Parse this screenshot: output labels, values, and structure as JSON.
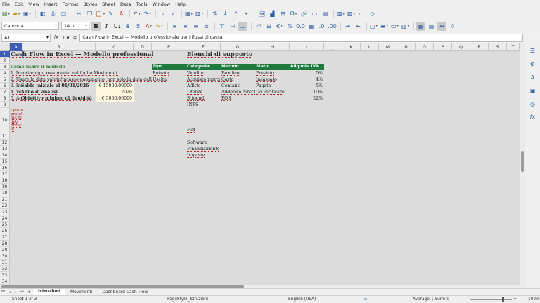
{
  "menu": [
    "File",
    "Edit",
    "View",
    "Insert",
    "Format",
    "Styles",
    "Sheet",
    "Data",
    "Tools",
    "Window",
    "Help"
  ],
  "toolbar2": {
    "font_name": "Cambria",
    "font_size": "14 pt"
  },
  "formula_bar": {
    "cell_ref": "A1",
    "content": "Cash Flow in Excel — Modello professionale per i flussi di cassa"
  },
  "columns": [
    "A",
    "B",
    "C",
    "D",
    "E",
    "F",
    "G",
    "H",
    "I",
    "J",
    "K",
    "L",
    "M",
    "N",
    "O",
    "P",
    "Q",
    "R",
    "S",
    "T"
  ],
  "rows": [
    "1",
    "2",
    "3",
    "4",
    "5",
    "6",
    "7",
    "8",
    "9",
    "10",
    "11",
    "12",
    "13",
    "14",
    "15",
    "16",
    "17",
    "18",
    "19",
    "20",
    "21",
    "22",
    "23",
    "24",
    "25",
    "26",
    "27",
    "28",
    "29",
    "30",
    "31",
    "32",
    "33",
    "34",
    "35"
  ],
  "cells": {
    "title": "Cash Flow in Excel — Modello professionale per i fluss",
    "title_right": "Elenchi di supporto",
    "section_how": "Come usare il modello",
    "steps": [
      "1. Inserire ogni movimento nel foglio Movimenti.",
      "2. Usare la data valuta/incasso-pagamento, non solo la data della fattura.",
      "3. Inse",
      "4. Ver",
      "5. Agg"
    ],
    "labels": {
      "saldo": "Saldo iniziale al 01/01/2026",
      "anno": "Anno di analisi",
      "obiettivo": "Obiettivo minimo di liquidità"
    },
    "values": {
      "saldo": "€ 15000.00000",
      "anno": "2026",
      "obiettivo": "€ 5000.00000"
    },
    "wrapped_a10": [
      "i perio",
      "protot",
      "ate di",
      "deti",
      "prese",
      "al."
    ],
    "lists": {
      "headers": [
        "Tipo",
        "Categoria",
        "Metodo",
        "Stato",
        "Aliquota IVA"
      ],
      "tipo": [
        "Entrata",
        "Uscita"
      ],
      "categoria": [
        "Vendite",
        "Acquisto merci",
        "Affitto",
        "Utenze",
        "Stipendi",
        "INPS",
        "F24",
        "Software",
        "Finanziamento",
        "Imposte"
      ],
      "metodo": [
        "Bonifico",
        "Carta",
        "Contanti",
        "Addebito diretto",
        "POS"
      ],
      "stato": [
        "Previsto",
        "Incassato",
        "Pagato",
        "Da verificare"
      ],
      "iva": [
        "0%",
        "4%",
        "5%",
        "10%",
        "22%"
      ]
    }
  },
  "sheet_tabs": [
    "Istruzioni",
    "Movimenti",
    "Dashboard Cash Flow"
  ],
  "active_tab": "Istruzioni",
  "status": {
    "sheet": "Sheet 1 of 3",
    "page_style": "PageStyle_Istruzioni",
    "language": "English (USA)",
    "summary": "Average: ; Sum: 0",
    "zoom": "100%"
  },
  "colors": {
    "header_green": "#1f7a3d",
    "selection_blue": "#3f5fb5",
    "section_green": "#2e7d32"
  }
}
